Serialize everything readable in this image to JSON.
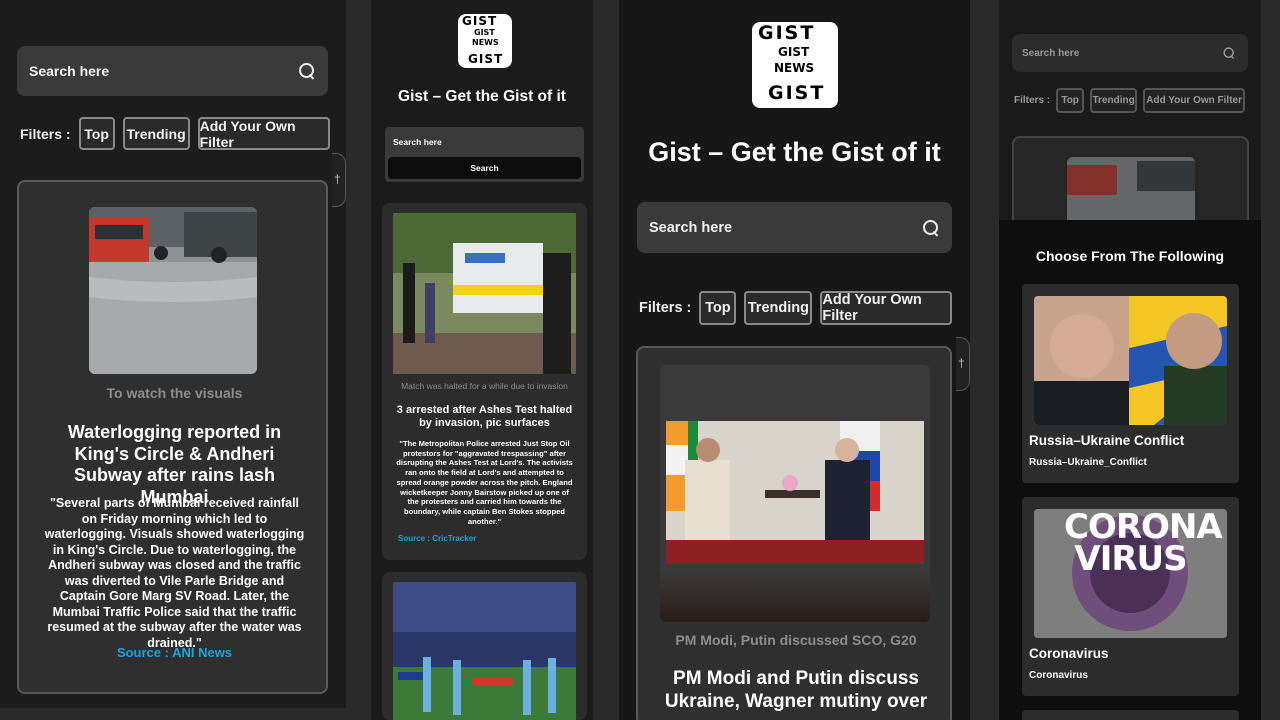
{
  "panel1": {
    "search_placeholder": "Search here",
    "filters_label": "Filters :",
    "filters": [
      "Top",
      "Trending",
      "Add Your Own Filter"
    ],
    "card": {
      "caption": "To watch the visuals",
      "headline": "Waterlogging reported in King's Circle & Andheri Subway after rains lash Mumbai",
      "body": "\"Several parts of Mumbai received rainfall on Friday morning which led to waterlogging. Visuals showed waterlogging in King's Circle. Due to waterlogging, the Andheri subway was closed and the traffic was diverted to Vile Parle Bridge and Captain Gore Marg SV Road. Later, the Mumbai Traffic Police said that the traffic resumed at the subway after the water was drained.\"",
      "source": "Source : ANI News"
    }
  },
  "panel2": {
    "logo_text": [
      "GIST",
      "GIST",
      "NEWS",
      "GIST"
    ],
    "title": "Gist – Get the Gist of it",
    "search_placeholder": "Search here",
    "search_button": "Search",
    "card": {
      "caption": "Match was halted for a while due to invasion",
      "headline": "3 arrested after Ashes Test halted by invasion, pic surfaces",
      "body": "\"The Metropolitan Police arrested Just Stop Oil protestors for \"aggravated trespassing\" after disrupting the Ashes Test at Lord's. The activists ran onto the field at Lord's and attempted to spread orange powder across the pitch. England wicketkeeper Jonny Bairstow picked up one of the protesters and carried him towards the boundary, while captain Ben Stokes stopped another.\"",
      "source": "Source : CricTracker"
    }
  },
  "panel3": {
    "title": "Gist – Get the Gist of it",
    "search_placeholder": "Search here",
    "filters_label": "Filters :",
    "filters": [
      "Top",
      "Trending",
      "Add Your Own Filter"
    ],
    "card": {
      "caption": "PM Modi, Putin discussed SCO, G20",
      "headline": "PM Modi and Putin discuss Ukraine, Wagner mutiny over"
    }
  },
  "panel4": {
    "search_placeholder": "Search here",
    "filters_label": "Filters :",
    "filters": [
      "Top",
      "Trending",
      "Add Your Own Filter"
    ],
    "modal_title": "Choose From The Following",
    "options": [
      {
        "title": "Russia–Ukraine Conflict",
        "tag": "Russia–Ukraine_Conflict"
      },
      {
        "title": "Coronavirus",
        "tag": "Coronavirus",
        "image_text": "CORONA VIRUS"
      }
    ]
  },
  "colors": {
    "accent": "#1aa3e0",
    "background": "#161616",
    "card": "#2f2f2f"
  }
}
